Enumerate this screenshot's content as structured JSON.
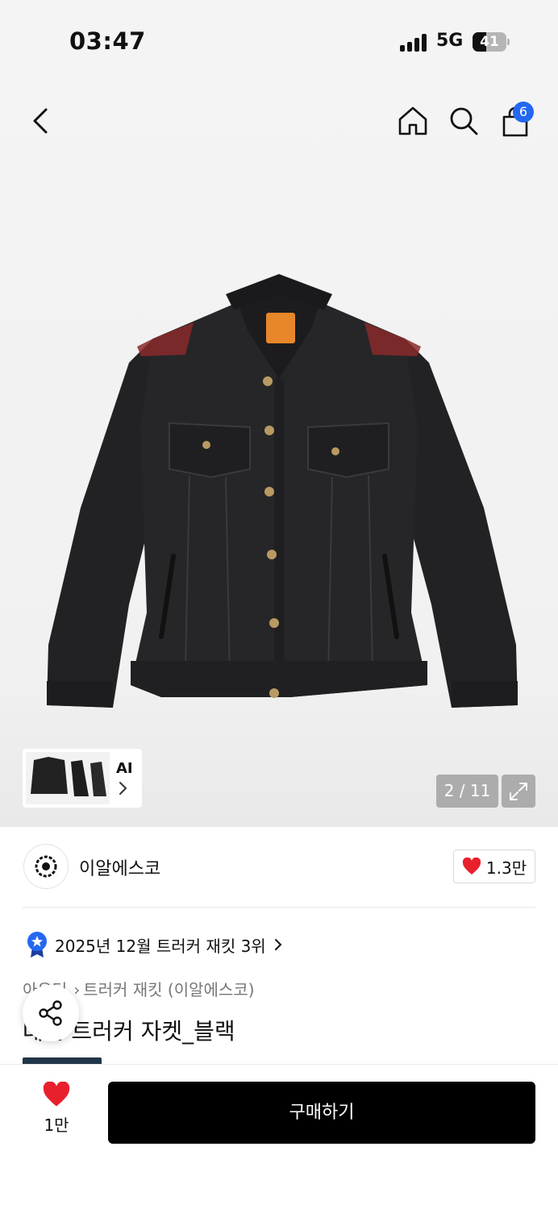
{
  "status_bar": {
    "time": "03:47",
    "network": "5G",
    "battery": "41",
    "battery_level": 0.41
  },
  "nav": {
    "cart_badge": "6"
  },
  "gallery": {
    "counter": "2 / 11",
    "ai_label": "AI"
  },
  "brand": {
    "name": "이알에스코",
    "likes": "1.3만"
  },
  "ranking": {
    "text": "2025년 12월 트러커 재킷 3위"
  },
  "breadcrumb": {
    "category": "아우터",
    "subcategory": "트러커 재킷 (이알에스코)"
  },
  "product": {
    "title": "데님 트러커 자켓_블랙"
  },
  "bottom_bar": {
    "like_count": "1만",
    "buy_label": "구매하기"
  },
  "colors": {
    "accent_blue": "#2468f2",
    "heart_red": "#e8202c",
    "buy_black": "#000000"
  }
}
